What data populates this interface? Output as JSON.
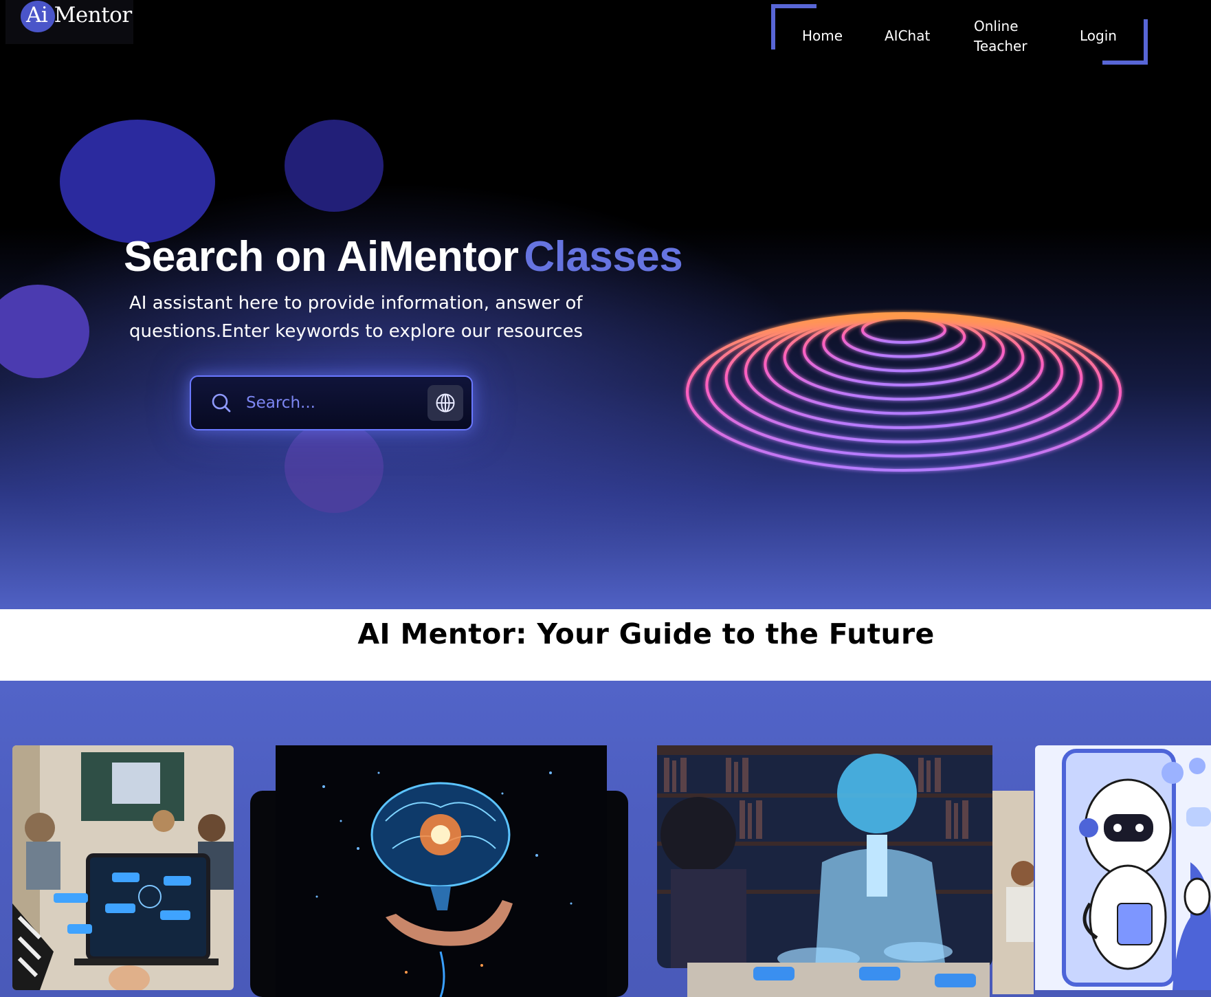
{
  "logo": {
    "text": "Ai Mentor"
  },
  "nav": {
    "home": "Home",
    "aichat": "AIChat",
    "online_teacher_line1": "Online",
    "online_teacher_line2": "Teacher",
    "login": "Login"
  },
  "hero": {
    "headline": "Search on AiMentor",
    "headline_accent": "Classes",
    "subtext_line1": "AI assistant here to provide information, answer of",
    "subtext_line2": "questions.Enter keywords to explore our resources"
  },
  "search": {
    "placeholder": "Search..."
  },
  "section": {
    "title": "AI Mentor: Your Guide to the Future"
  },
  "colors": {
    "accent": "#5866d6",
    "headline_accent": "#6674e0",
    "gallery_bg": "#5264c8"
  },
  "icons": [
    "search-icon",
    "globe-icon"
  ]
}
